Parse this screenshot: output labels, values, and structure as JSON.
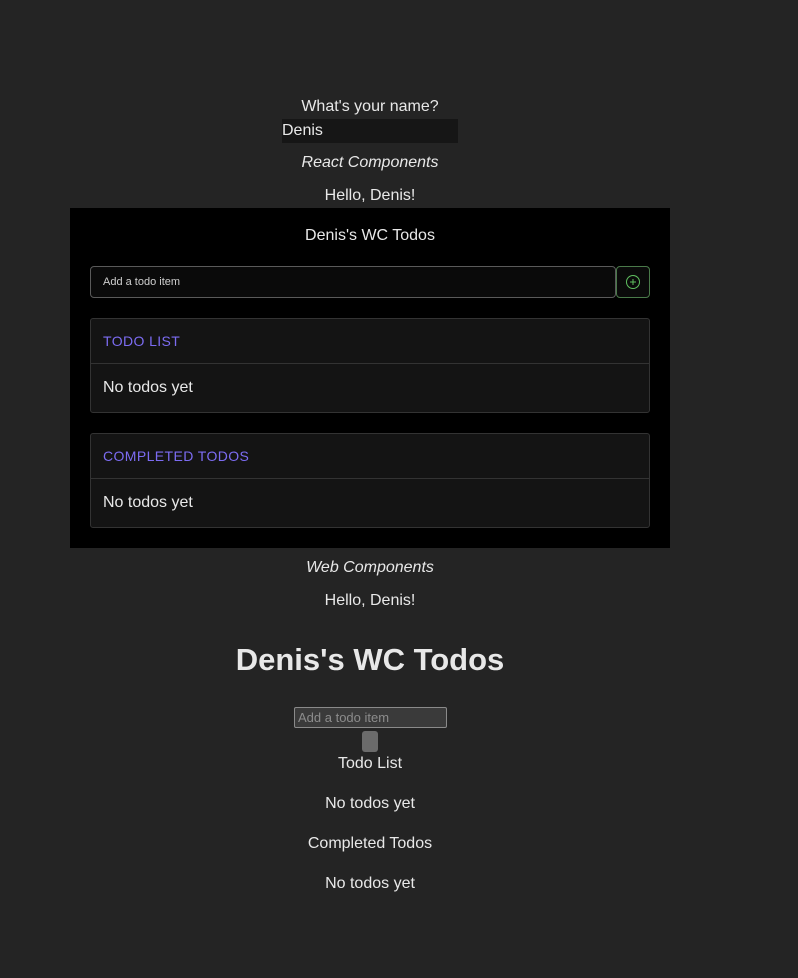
{
  "name_prompt": {
    "question": "What's your name?",
    "value": "Denis"
  },
  "react": {
    "heading": "React Components",
    "greeting": "Hello, Denis!",
    "panel": {
      "title": "Denis's WC Todos",
      "input_placeholder": "Add a todo item",
      "add_icon": "plus-circle-icon",
      "todo_list": {
        "header": "TODO LIST",
        "empty": "No todos yet"
      },
      "completed": {
        "header": "COMPLETED TODOS",
        "empty": "No todos yet"
      }
    }
  },
  "wc": {
    "heading": "Web Components",
    "greeting": "Hello, Denis!",
    "title": "Denis's WC Todos",
    "input_placeholder": "Add a todo item",
    "todo_list_label": "Todo List",
    "todo_list_empty": "No todos yet",
    "completed_label": "Completed Todos",
    "completed_empty": "No todos yet"
  },
  "colors": {
    "background": "#242424",
    "panel": "#000000",
    "accent_purple": "#7c6cf2",
    "accent_green": "#5fbf5f"
  }
}
